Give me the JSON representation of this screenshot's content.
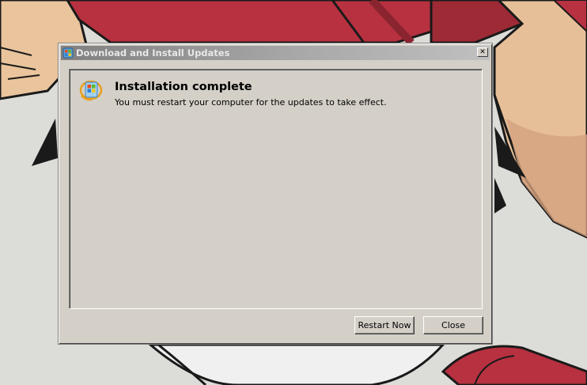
{
  "window": {
    "title": "Download and Install Updates",
    "close_glyph": "✕",
    "title_icon": "windows-update-icon"
  },
  "content": {
    "icon": "windows-update-icon",
    "heading": "Installation complete",
    "message": "You must restart your computer for the updates to take effect."
  },
  "buttons": {
    "restart_label": "Restart Now",
    "close_label": "Close"
  },
  "colors": {
    "dialog_face": "#d4d0c8",
    "titlebar_inactive_start": "#808080",
    "titlebar_inactive_end": "#c0c0c0",
    "wallpaper_red": "#b73140",
    "wallpaper_skin": "#e8c09a"
  }
}
